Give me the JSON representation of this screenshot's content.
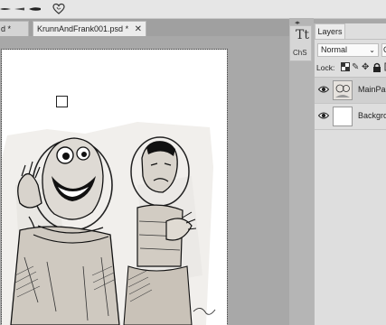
{
  "toolbar": {
    "brush_presets": [
      "brush-preset-1",
      "brush-preset-2",
      "brush-preset-3",
      "heart-shape-preset"
    ]
  },
  "tabs": [
    {
      "label": "d *",
      "closable": false
    },
    {
      "label": "KrunnAndFrank001.psd *",
      "closable": true,
      "close_glyph": "✕",
      "active": true
    }
  ],
  "side_panel": {
    "tool_glyph": "Tt",
    "tool_label": "ChS",
    "collapse_glyph": "◂▸"
  },
  "layers_panel": {
    "tab_label": "Layers",
    "blend_mode": "Normal",
    "opacity_label": "O",
    "lock_label": "Lock:",
    "lock_icons": [
      "lock-transparency-icon",
      "lock-paint-icon",
      "lock-move-icon",
      "lock-all-icon",
      "lock-artboard-icon"
    ],
    "layers": [
      {
        "name": "MainPar",
        "visible": true,
        "selected": true
      },
      {
        "name": "Backgro",
        "visible": true,
        "selected": false
      }
    ]
  },
  "colors": {
    "canvas_bg": "#a8a8a8",
    "toolbar_bg": "#e6e6e6",
    "panel_bg": "#dedede",
    "selected_layer": "#d0d0d0"
  }
}
